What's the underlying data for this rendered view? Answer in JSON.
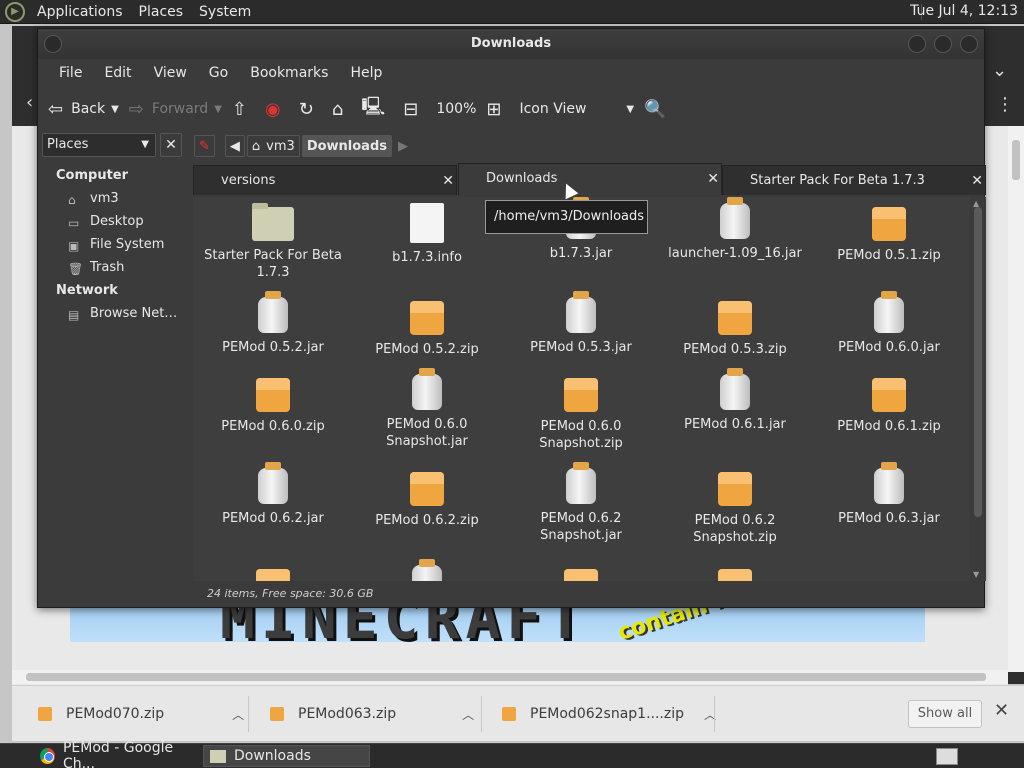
{
  "top_panel": {
    "menus": [
      "Applications",
      "Places",
      "System"
    ],
    "clock": "Tue Jul  4, 12:13"
  },
  "window": {
    "title": "Downloads",
    "menubar": [
      "File",
      "Edit",
      "View",
      "Go",
      "Bookmarks",
      "Help"
    ],
    "toolbar": {
      "back_label": "Back",
      "forward_label": "Forward",
      "zoom": "100%",
      "view_mode": "Icon View"
    }
  },
  "sidebar": {
    "selector_label": "Places",
    "computer_heading": "Computer",
    "computer_items": [
      "vm3",
      "Desktop",
      "File System",
      "Trash"
    ],
    "network_heading": "Network",
    "network_items": [
      "Browse Net…"
    ]
  },
  "location": {
    "crumbs": [
      "vm3",
      "Downloads"
    ]
  },
  "tabs": [
    {
      "label": "versions",
      "active": false
    },
    {
      "label": "Downloads",
      "active": true
    },
    {
      "label": "Starter Pack For Beta 1.7.3",
      "active": false
    }
  ],
  "tooltip": "/home/vm3/Downloads",
  "files": [
    {
      "name": "Starter Pack For Beta 1.7.3",
      "type": "folder"
    },
    {
      "name": "b1.7.3.info",
      "type": "info"
    },
    {
      "name": "b1.7.3.jar",
      "type": "jar"
    },
    {
      "name": "launcher-1.09_16.jar",
      "type": "jar"
    },
    {
      "name": "PEMod 0.5.1.zip",
      "type": "zip"
    },
    {
      "name": "PEMod 0.5.2.jar",
      "type": "jar"
    },
    {
      "name": "PEMod 0.5.2.zip",
      "type": "zip"
    },
    {
      "name": "PEMod 0.5.3.jar",
      "type": "jar"
    },
    {
      "name": "PEMod 0.5.3.zip",
      "type": "zip"
    },
    {
      "name": "PEMod 0.6.0.jar",
      "type": "jar"
    },
    {
      "name": "PEMod 0.6.0.zip",
      "type": "zip"
    },
    {
      "name": "PEMod 0.6.0 Snapshot.jar",
      "type": "jar"
    },
    {
      "name": "PEMod 0.6.0 Snapshot.zip",
      "type": "zip"
    },
    {
      "name": "PEMod 0.6.1.jar",
      "type": "jar"
    },
    {
      "name": "PEMod 0.6.1.zip",
      "type": "zip"
    },
    {
      "name": "PEMod 0.6.2.jar",
      "type": "jar"
    },
    {
      "name": "PEMod 0.6.2.zip",
      "type": "zip"
    },
    {
      "name": "PEMod 0.6.2 Snapshot.jar",
      "type": "jar"
    },
    {
      "name": "PEMod 0.6.2 Snapshot.zip",
      "type": "zip"
    },
    {
      "name": "PEMod 0.6.3.jar",
      "type": "jar"
    }
  ],
  "status": "24 items, Free space: 30.6 GB",
  "downloads_shelf": {
    "items": [
      "PEMod070.zip",
      "PEMod063.zip",
      "PEMod062snap1....zip"
    ],
    "show_all_label": "Show all"
  },
  "taskbar": {
    "tasks": [
      "PEMod - Google Ch...",
      "Downloads"
    ]
  },
  "banner": {
    "logo_text": "MINECRAFT",
    "splash_text": "contain nuts!"
  },
  "colors": {
    "panel_bg": "#2b2b2b",
    "window_bg": "#3b3b3b",
    "zip_icon": "#f0a640",
    "shelf_bg": "#e7e7e7"
  }
}
